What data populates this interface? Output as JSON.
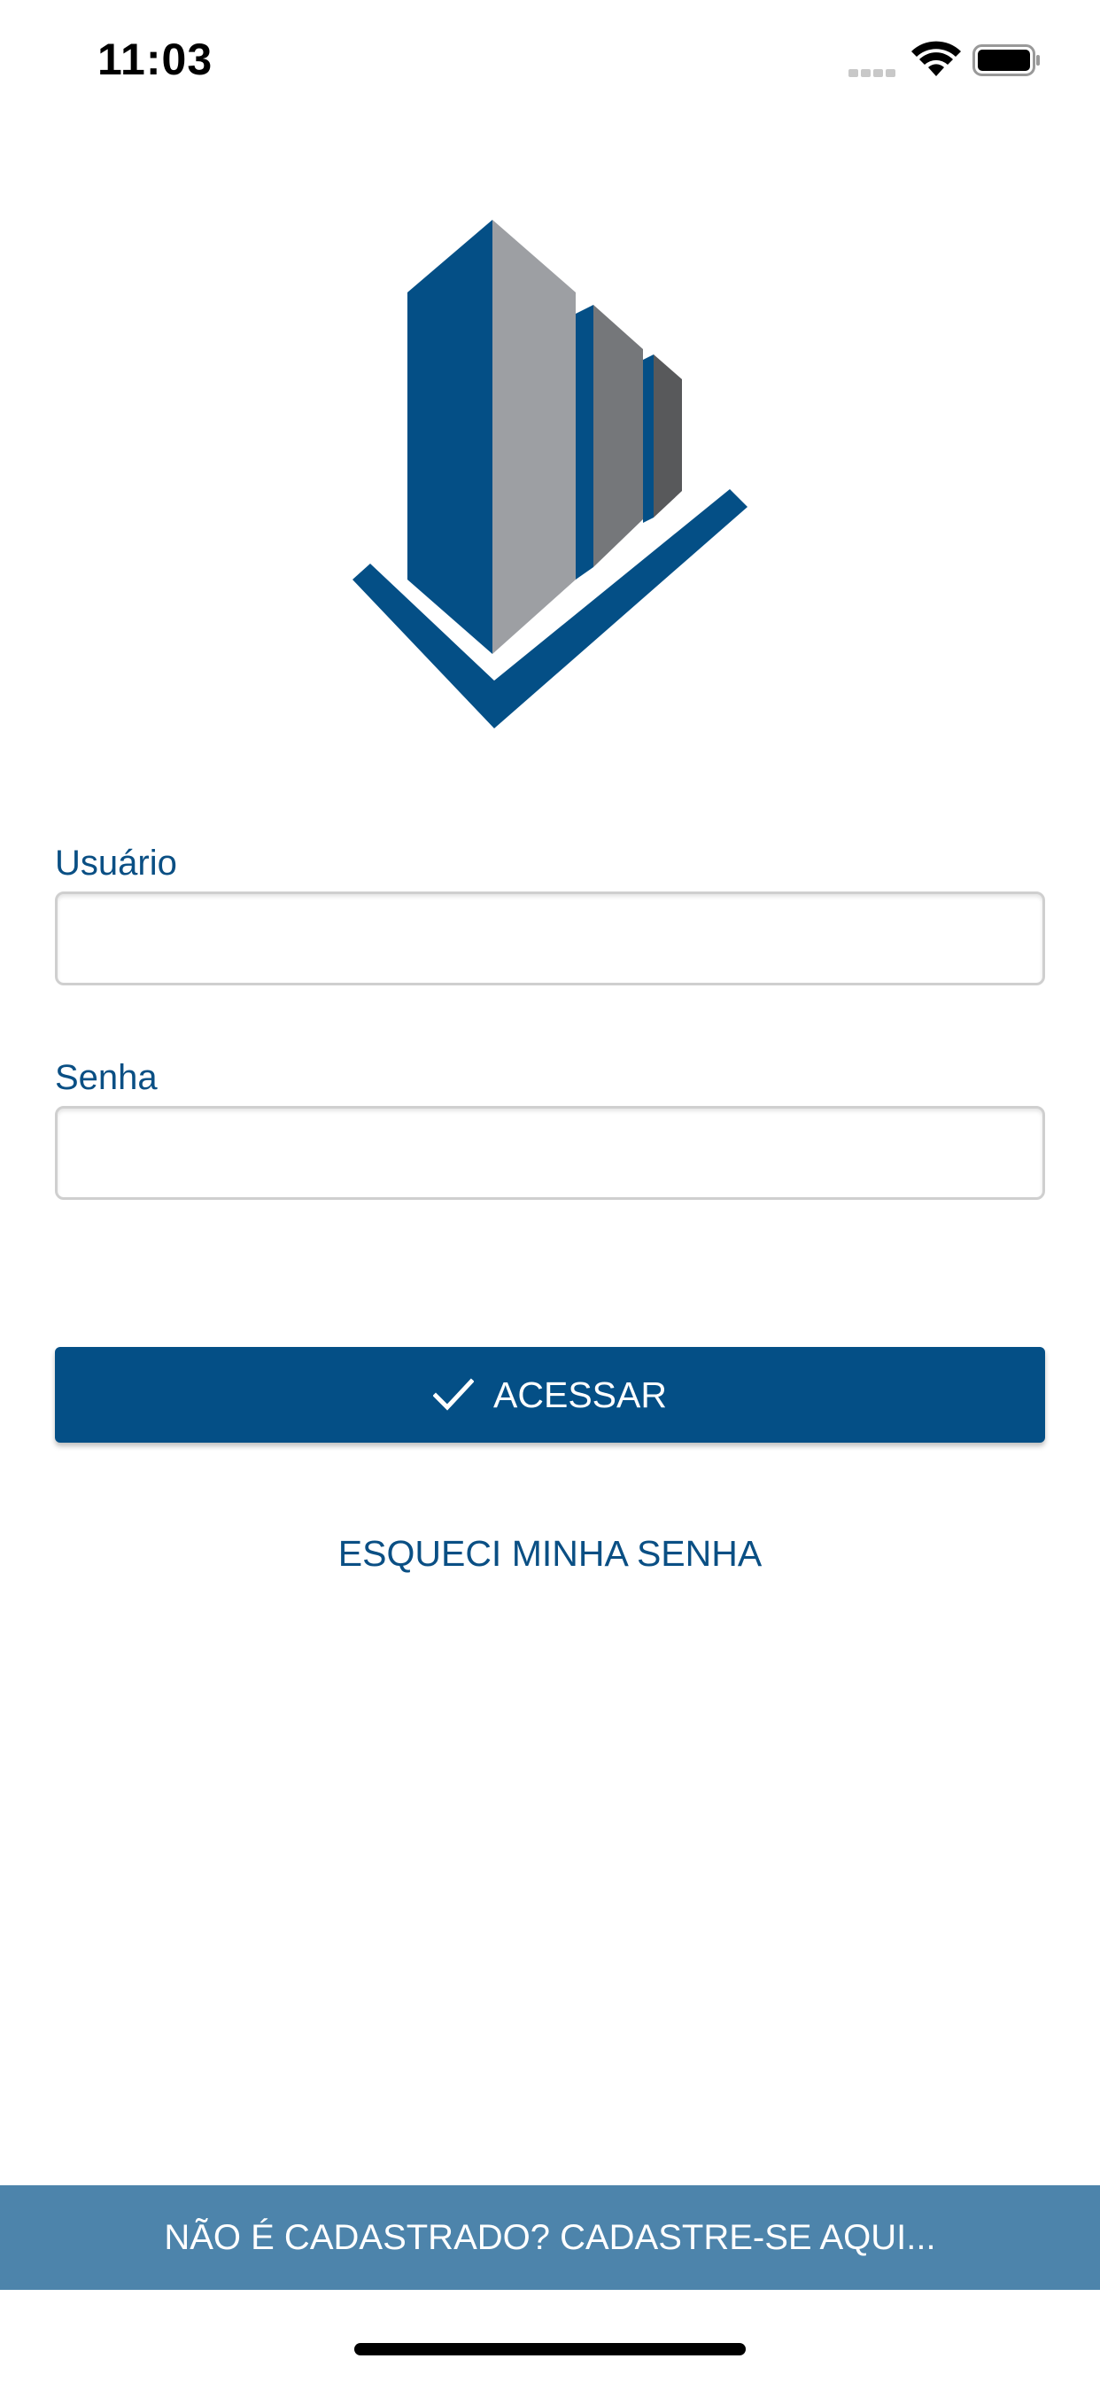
{
  "status_bar": {
    "time": "11:03",
    "wifi_icon": "wifi-icon",
    "battery_icon": "battery-full-icon"
  },
  "logo": {
    "icon": "buildings-logo",
    "colors": {
      "blue": "#044f86",
      "light_gray": "#9d9fa3",
      "mid_gray": "#75777a",
      "dark_gray": "#58595b"
    }
  },
  "form": {
    "username_label": "Usuário",
    "username_value": "",
    "password_label": "Senha",
    "password_value": "",
    "submit_label": "ACESSAR",
    "submit_icon": "check-icon",
    "forgot_label": "ESQUECI MINHA SENHA"
  },
  "footer": {
    "register_label": "NÃO É CADASTRADO? CADASTRE-SE AQUI..."
  },
  "colors": {
    "primary": "#044f86",
    "register_bar": "#4d84ab",
    "label": "#0a4f84"
  }
}
